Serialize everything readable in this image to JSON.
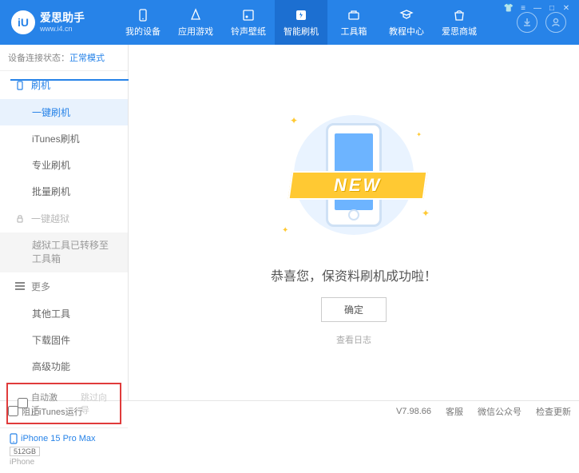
{
  "brand": {
    "name": "爱思助手",
    "url": "www.i4.cn",
    "logo_letter": "iU"
  },
  "nav": [
    {
      "label": "我的设备"
    },
    {
      "label": "应用游戏"
    },
    {
      "label": "铃声壁纸"
    },
    {
      "label": "智能刷机"
    },
    {
      "label": "工具箱"
    },
    {
      "label": "教程中心"
    },
    {
      "label": "爱思商城"
    }
  ],
  "sidebar": {
    "status_label": "设备连接状态：",
    "status_value": "正常模式",
    "flash_section": "刷机",
    "items_flash": [
      {
        "label": "一键刷机"
      },
      {
        "label": "iTunes刷机"
      },
      {
        "label": "专业刷机"
      },
      {
        "label": "批量刷机"
      }
    ],
    "jailbreak_section": "一键越狱",
    "jailbreak_note": "越狱工具已转移至工具箱",
    "more_section": "更多",
    "items_more": [
      {
        "label": "其他工具"
      },
      {
        "label": "下载固件"
      },
      {
        "label": "高级功能"
      }
    ],
    "auto_activate": "自动激活",
    "skip_setup": "跳过向导"
  },
  "device": {
    "name": "iPhone 15 Pro Max",
    "storage": "512GB",
    "type": "iPhone"
  },
  "main": {
    "ribbon": "NEW",
    "success": "恭喜您，保资料刷机成功啦！",
    "ok": "确定",
    "log_link": "查看日志"
  },
  "footer": {
    "block_itunes": "阻止iTunes运行",
    "version": "V7.98.66",
    "items": [
      "客服",
      "微信公众号",
      "检查更新"
    ]
  }
}
